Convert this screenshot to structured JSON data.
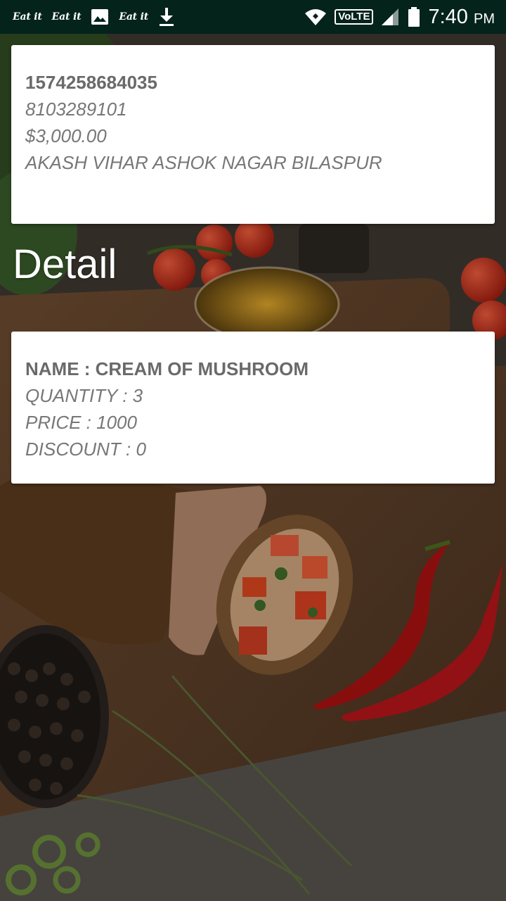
{
  "status_bar": {
    "notifications": [
      "Eat it",
      "Eat it",
      "image-icon",
      "Eat it",
      "download-icon"
    ],
    "volte": "VoLTE",
    "time": "7:40",
    "ampm": "PM"
  },
  "order": {
    "order_id": "1574258684035",
    "phone": "8103289101",
    "total": "$3,000.00",
    "address": "AKASH VIHAR ASHOK NAGAR BILASPUR"
  },
  "section_title": "Detail",
  "detail": {
    "name": "NAME : CREAM OF MUSHROOM",
    "quantity": "QUANTITY : 3",
    "price": "PRICE : 1000",
    "discount": "DISCOUNT : 0"
  },
  "colors": {
    "status_bar": "#03231b",
    "card_text": "#6f6f6f",
    "title_text": "#ffffff"
  }
}
